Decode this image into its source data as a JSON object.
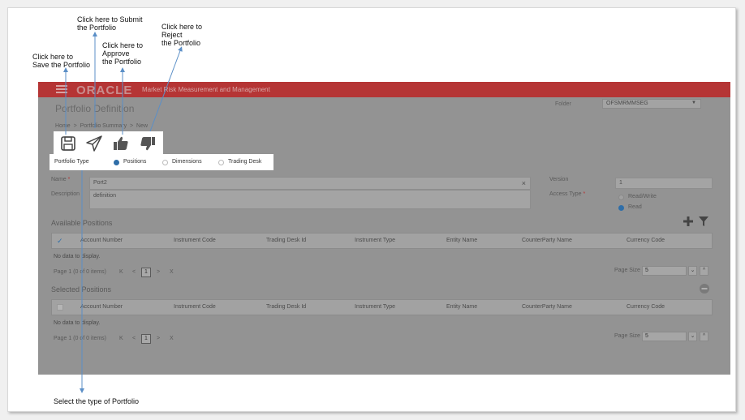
{
  "callouts": {
    "submit": "Click here  to Submit\nthe Portfolio",
    "reject": "Click here  to\nReject\nthe Portfolio",
    "approve": "Click here  to\nApprove\nthe Portfolio",
    "save": "Click here  to\nSave the Portfolio",
    "select_type": "Select the type of Portfolio"
  },
  "header": {
    "logo": "ORACLE",
    "app_name": "Market Risk Measurement and Management"
  },
  "page": {
    "title": "Portfolio Definition",
    "folder_label": "Folder",
    "folder_value": "OFSMRMMSEG"
  },
  "breadcrumb": {
    "home": "Home",
    "sep": ">",
    "summary": "Portfolio Summary",
    "current": "New"
  },
  "portfolio_type": {
    "label": "Portfolio Type",
    "options": [
      "Positions",
      "Dimensions",
      "Trading Desk"
    ],
    "selected": "Positions"
  },
  "form": {
    "name_label": "Name",
    "required_mark": "*",
    "name_value": "Port2",
    "clear_glyph": "×",
    "description_label": "Description",
    "description_value": "definition",
    "version_label": "Version",
    "version_value": "1",
    "access_type_label": "Access Type",
    "access_options": [
      "Read/Write",
      "Read"
    ],
    "access_selected": "Read"
  },
  "available_positions": {
    "title": "Available Positions",
    "columns": [
      "Account Number",
      "Instrument Code",
      "Trading Desk Id",
      "Instrument Type",
      "Entity Name",
      "CounterParty Name",
      "Currency Code"
    ],
    "empty_text": "No data to display.",
    "page_label": "Page",
    "page_number": "1",
    "page_info": "(0 of 0 items)",
    "page_size_label": "Page Size",
    "page_size_value": "5"
  },
  "selected_positions": {
    "title": "Selected Positions",
    "columns": [
      "Account Number",
      "Instrument Code",
      "Trading Desk Id",
      "Instrument Type",
      "Entity Name",
      "CounterParty Name",
      "Currency Code"
    ],
    "empty_text": "No data to display.",
    "page_label": "Page",
    "page_number": "1",
    "page_info": "(0 of 0 items)",
    "page_size_label": "Page Size",
    "page_size_value": "5"
  },
  "pager_glyphs": {
    "first": "K",
    "prev": "<",
    "next": ">",
    "last": "X",
    "down": "⌄",
    "up": "^"
  },
  "colors": {
    "brand_bar": "#b53535",
    "overlay": "#939393",
    "radio_selected": "#2f6ea8",
    "arrow": "#5b8fc7"
  }
}
